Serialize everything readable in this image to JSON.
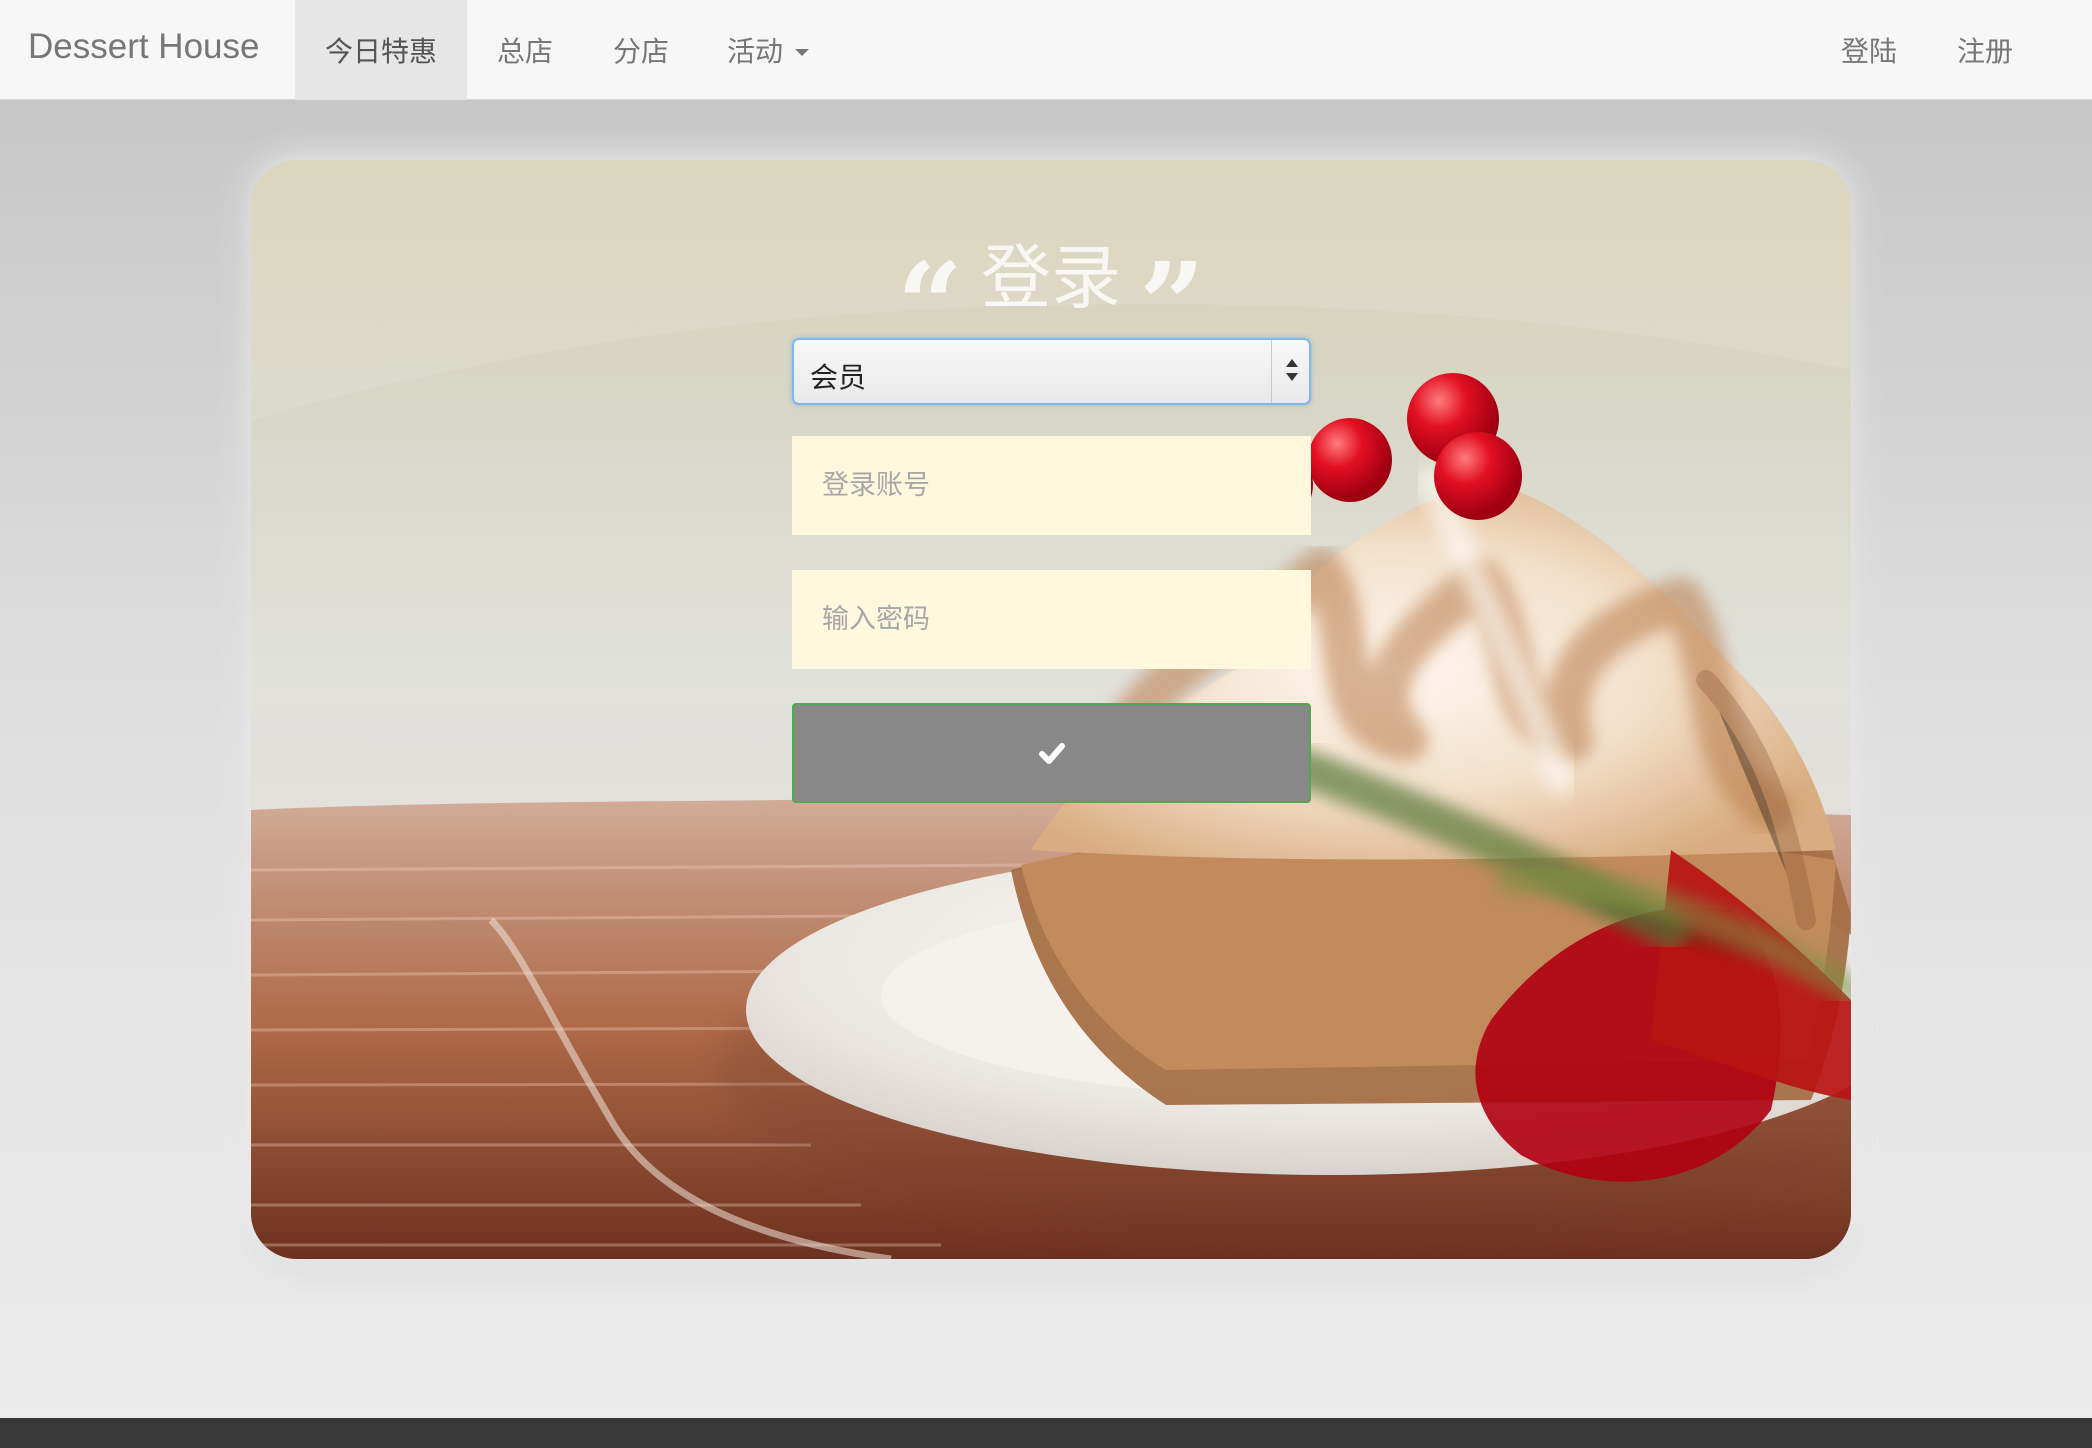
{
  "brand": {
    "name": "Dessert House"
  },
  "nav": {
    "items": [
      {
        "label": "今日特惠",
        "active": true
      },
      {
        "label": "总店",
        "active": false
      },
      {
        "label": "分店",
        "active": false
      },
      {
        "label": "活动",
        "active": false
      }
    ],
    "right_items": [
      {
        "label": "登陆"
      },
      {
        "label": "注册"
      }
    ]
  },
  "login": {
    "title": "登录",
    "role_selected": "会员",
    "account_placeholder": "登录账号",
    "password_placeholder": "输入密码",
    "submit_icon": "check-icon"
  },
  "theme": {
    "navbar_background": "#f7f7f7",
    "input_background": "#fff8df",
    "submit_background": "#888888",
    "submit_border": "#4fa953",
    "footer_background": "#393939"
  }
}
